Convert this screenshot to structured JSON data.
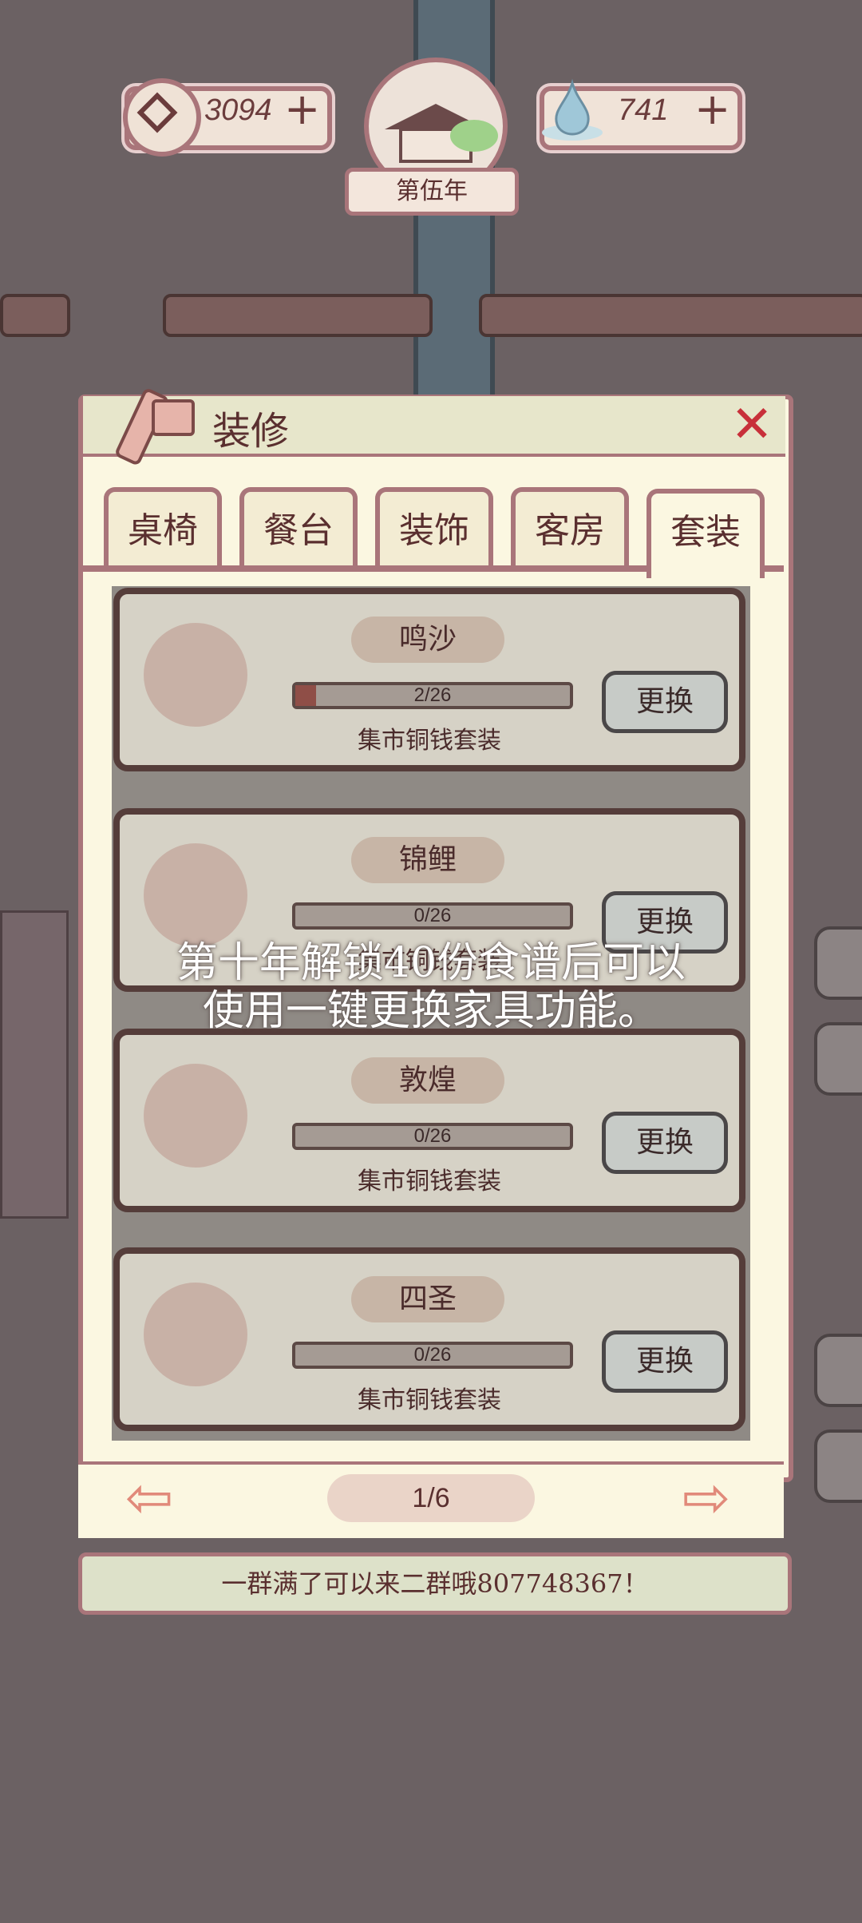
{
  "hud": {
    "coin_icon": "copper-coin-icon",
    "coins": "3094",
    "water_icon": "water-drop-icon",
    "water": "741",
    "plus": "+",
    "year": "第伍年"
  },
  "panel": {
    "title": "装修",
    "close_icon": "close-x-icon",
    "tabs": [
      {
        "label": "桌椅",
        "active": false
      },
      {
        "label": "餐台",
        "active": false
      },
      {
        "label": "装饰",
        "active": false
      },
      {
        "label": "客房",
        "active": false
      },
      {
        "label": "套装",
        "active": true
      }
    ],
    "cards": [
      {
        "name": "鸣沙",
        "progress": "2/26",
        "progress_fraction": 0.077,
        "subtitle": "集市铜钱套装",
        "button": "更换",
        "portrait": "god-of-wealth-icon"
      },
      {
        "name": "锦鲤",
        "progress": "0/26",
        "progress_fraction": 0,
        "subtitle": "集市铜钱套装",
        "button": "更换",
        "portrait": "koi-god-icon"
      },
      {
        "name": "敦煌",
        "progress": "0/26",
        "progress_fraction": 0,
        "subtitle": "集市铜钱套装",
        "button": "更换",
        "portrait": "pipa-player-icon"
      },
      {
        "name": "四圣",
        "progress": "0/26",
        "progress_fraction": 0,
        "subtitle": "集市铜钱套装",
        "button": "更换",
        "portrait": "black-tortoise-icon"
      }
    ],
    "overlay_text": "第十年解锁40份食谱后可以使用一键更换家具功能。",
    "page": "1/6"
  },
  "marquee": "一群满了可以来二群哦807748367！"
}
